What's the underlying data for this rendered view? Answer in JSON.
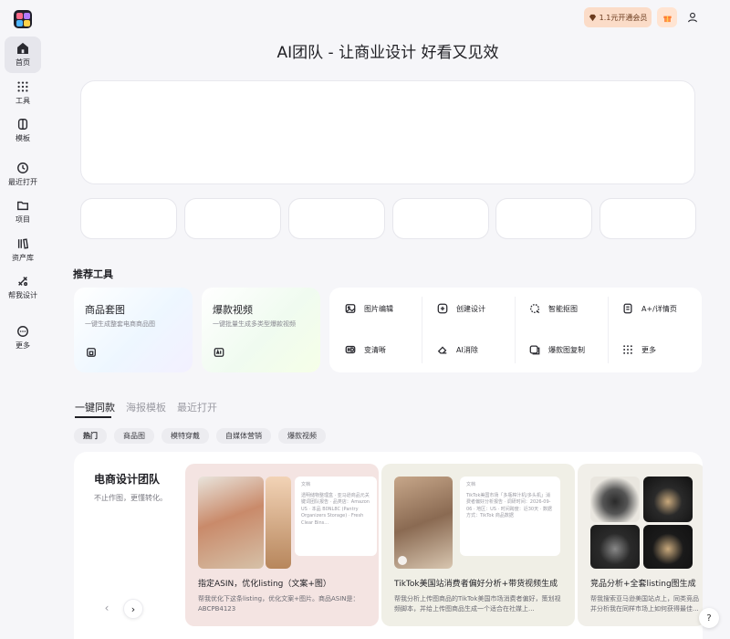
{
  "sidebar": {
    "items": [
      {
        "label": "首页",
        "icon": "home-icon",
        "active": true
      },
      {
        "label": "工具",
        "icon": "grid-dots-icon"
      },
      {
        "label": "模板",
        "icon": "template-icon"
      },
      {
        "label": "最近打开",
        "icon": "clock-icon"
      },
      {
        "label": "项目",
        "icon": "folder-icon"
      },
      {
        "label": "资产库",
        "icon": "library-icon"
      },
      {
        "label": "帮我设计",
        "icon": "magic-tools-icon"
      },
      {
        "label": "更多",
        "icon": "more-circle-icon"
      }
    ]
  },
  "header": {
    "vip_label": "1.1元开通会员",
    "title": "AI团队 - 让商业设计 好看又见效"
  },
  "recommended": {
    "title": "推荐工具",
    "cards": [
      {
        "title": "商品套图",
        "subtitle": "一键生成整套电商商品图",
        "icon": "product-image-icon"
      },
      {
        "title": "爆款视频",
        "subtitle": "一键批量生成多类型爆款视频",
        "icon": "ai-video-icon"
      }
    ],
    "grid": [
      {
        "label": "图片编辑",
        "icon": "image-icon"
      },
      {
        "label": "创建设计",
        "icon": "plus-square-icon"
      },
      {
        "label": "智能抠图",
        "icon": "cutout-icon"
      },
      {
        "label": "A+/详情页",
        "icon": "detail-page-icon"
      },
      {
        "label": "变清晰",
        "icon": "hd-icon"
      },
      {
        "label": "AI消除",
        "icon": "eraser-icon"
      },
      {
        "label": "爆款图复制",
        "icon": "copy-image-icon"
      },
      {
        "label": "更多",
        "icon": "grid-dots-icon"
      }
    ]
  },
  "tabs": [
    "一键同款",
    "海报模板",
    "最近打开"
  ],
  "chips": [
    "热门",
    "商品图",
    "模特穿戴",
    "自媒体营销",
    "爆款视频"
  ],
  "team": {
    "title": "电商设计团队",
    "subtitle": "不止作图，更懂转化。",
    "cases": [
      {
        "title": "指定ASIN，优化listing（文案+图）",
        "desc": "帮我优化下这条listing，优化文案+图片。商品ASIN是：ABCPB4123",
        "doc_tag": "文档",
        "doc_text": "透明储物整理盒 · 亚马逊商品元关键词团队报告 · 品类店：Amazon US · 本品 B0NL8C (Pantry Organizers Storage) · Fresh Clear Bins..."
      },
      {
        "title": "TikTok美国站消费者偏好分析+带货视频生成",
        "desc": "帮我分析上传图商品的TikTok美国市场消费者偏好，策划视频脚本，并给上传图商品生成一个适合在社媒上...",
        "doc_tag": "文档",
        "doc_text": "TikTok美国市场「多瓶榨汁机/多头机」消费者偏好分析报告 · 调研时间：2026-09-06 · 地区：US · 时间跨度：近30天 · 数据方式：TikTok 商品数据"
      },
      {
        "title": "竞品分析+全套listing图生成",
        "desc": "帮我搜索亚马逊美国站点上，同类竞品并分析我在同样市场上如何获得最佳...",
        "doc_tag": "",
        "doc_text": ""
      }
    ]
  },
  "help_label": "?"
}
